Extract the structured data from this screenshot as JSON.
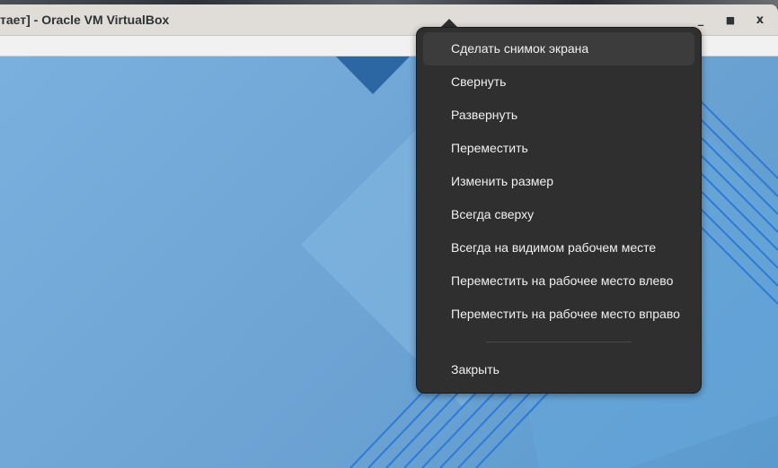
{
  "window": {
    "title": "тает] - Oracle VM VirtualBox",
    "minimize": "_",
    "maximize": "▫",
    "close": "x"
  },
  "context_menu": {
    "items": [
      {
        "label": "Сделать снимок экрана",
        "highlighted": true
      },
      {
        "label": "Свернуть"
      },
      {
        "label": "Развернуть"
      },
      {
        "label": "Переместить"
      },
      {
        "label": "Изменить размер"
      },
      {
        "label": "Всегда сверху"
      },
      {
        "label": "Всегда на видимом рабочем месте"
      },
      {
        "label": "Переместить на рабочее место влево"
      },
      {
        "label": "Переместить на рабочее место вправо"
      }
    ],
    "close_label": "Закрыть"
  }
}
